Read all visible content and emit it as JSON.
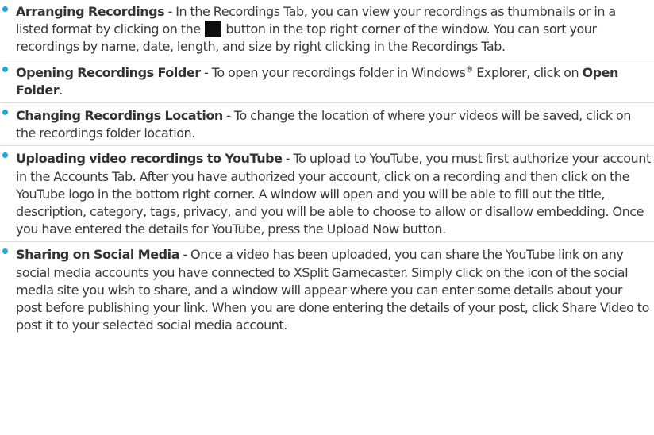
{
  "accent_color": "#1ea7d8",
  "items": [
    {
      "title": "Arranging Recordings",
      "text_before_icon": " - In the Recordings Tab, you can view your recordings as thumbnails or in a listed format by clicking on the ",
      "icon": "view-toggle-icon",
      "text_after_icon": " button in the top right corner of the window. You can sort your recordings by name, date, length, and size by right clicking in the Recordings Tab."
    },
    {
      "title": "Opening Recordings Folder",
      "text_before": " - To open your recordings folder in Windows",
      "registered": "®",
      "text_middle": " Explorer, click on ",
      "bold_text": "Open Folder",
      "text_after": "."
    },
    {
      "title": "Changing Recordings Location",
      "text": " - To change the location of where your videos will be saved, click on the recordings folder location."
    },
    {
      "title": "Uploading video recordings to YouTube",
      "text": " - To upload to YouTube, you must first authorize your account in the Accounts Tab. After you have authorized your account, click on a recording and then click on the YouTube logo in the bottom right corner. A window will open and you will be able to fill out the title, description, category, tags, privacy, and you will be able to choose to allow or disallow embedding. Once you have entered the details for YouTube, press the Upload Now button."
    },
    {
      "title": "Sharing on Social Media",
      "text": " - Once a video has been uploaded, you can share the YouTube link on any social media accounts you have connected to XSplit Gamecaster. Simply click on the icon of the social media site you wish to share, and a window will appear where you can enter some details about your post before publishing your link. When you are done entering the details of your post, click Share Video to post it to your selected social media account."
    }
  ]
}
